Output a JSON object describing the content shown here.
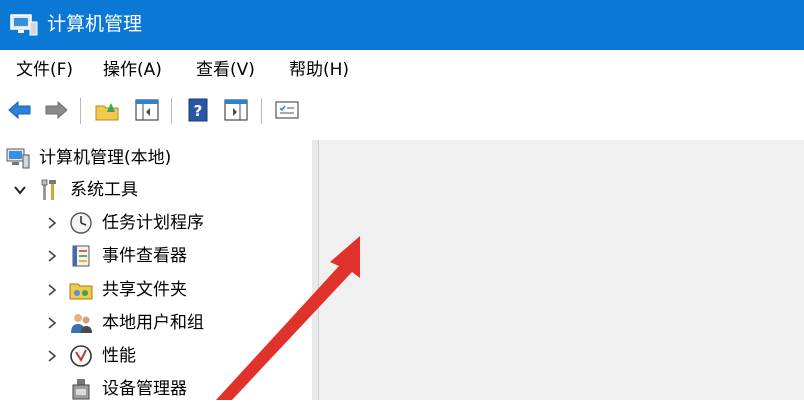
{
  "window": {
    "title": "计算机管理",
    "accent": "#0a78d4"
  },
  "menu": {
    "items": [
      {
        "label": "文件(F)"
      },
      {
        "label": "操作(A)"
      },
      {
        "label": "查看(V)"
      },
      {
        "label": "帮助(H)"
      }
    ]
  },
  "toolbar": {
    "buttons": [
      "back-icon",
      "forward-icon",
      "folder-up-icon",
      "show-hide-tree-icon",
      "help-icon",
      "action-pane-icon",
      "properties-icon"
    ]
  },
  "tree": {
    "root": {
      "label": "计算机管理(本地)",
      "icon": "computer-management-icon"
    },
    "system_tools": {
      "label": "系统工具",
      "icon": "tools-icon"
    },
    "children": [
      {
        "label": "任务计划程序",
        "icon": "clock-icon"
      },
      {
        "label": "事件查看器",
        "icon": "event-viewer-icon"
      },
      {
        "label": "共享文件夹",
        "icon": "shared-folder-icon"
      },
      {
        "label": "本地用户和组",
        "icon": "users-icon"
      },
      {
        "label": "性能",
        "icon": "performance-icon"
      },
      {
        "label": "设备管理器",
        "icon": "device-manager-icon"
      }
    ]
  },
  "annotation": {
    "color": "#e0312b"
  }
}
